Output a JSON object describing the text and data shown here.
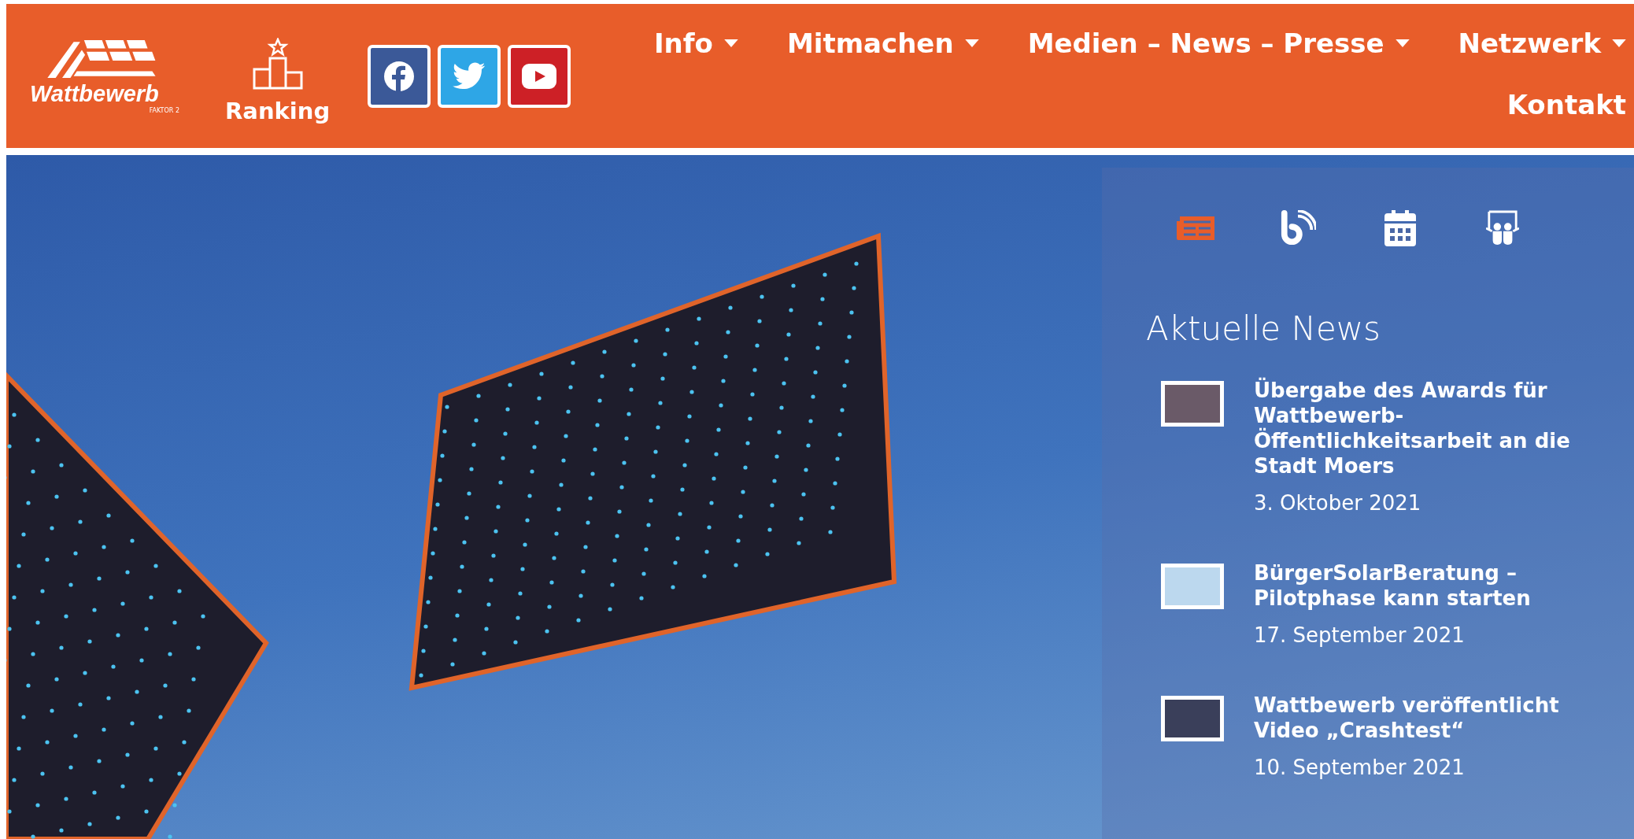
{
  "logo": {
    "name": "Wattbewerb",
    "tagline": "FAKTOR 2"
  },
  "ranking": {
    "label": "Ranking"
  },
  "social": [
    {
      "kind": "facebook"
    },
    {
      "kind": "twitter"
    },
    {
      "kind": "youtube"
    }
  ],
  "nav_rows": [
    [
      {
        "label": "Info",
        "dropdown": true
      },
      {
        "label": "Mitmachen",
        "dropdown": true
      },
      {
        "label": "Medien – News – Presse",
        "dropdown": true
      },
      {
        "label": "Netzwerk",
        "dropdown": true
      }
    ],
    [
      {
        "label": "Kontakt",
        "dropdown": false
      }
    ]
  ],
  "sidebar": {
    "tabs": [
      {
        "kind": "news",
        "selected": true
      },
      {
        "kind": "blog",
        "selected": false
      },
      {
        "kind": "calendar",
        "selected": false
      },
      {
        "kind": "slides",
        "selected": false
      }
    ],
    "heading": "Aktuelle News",
    "news": [
      {
        "title": "Übergabe des Awards für Wattbewerb-Öffentlichkeitsarbeit an die Stadt Moers",
        "date": "3. Oktober 2021"
      },
      {
        "title": "BürgerSolarBeratung – Pilotphase kann starten",
        "date": "17. September 2021"
      },
      {
        "title": "Wattbewerb veröffentlicht Video „Crashtest“",
        "date": "10. September 2021"
      }
    ]
  }
}
